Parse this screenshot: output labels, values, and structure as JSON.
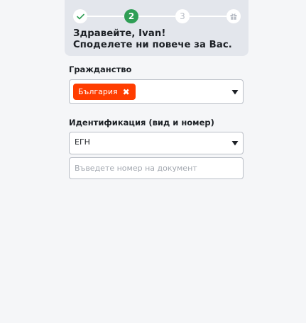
{
  "stepper": {
    "steps": [
      {
        "state": "done",
        "icon": "check-icon",
        "label": ""
      },
      {
        "state": "active",
        "label": "2"
      },
      {
        "state": "upcoming",
        "label": "3"
      },
      {
        "state": "upcoming",
        "icon": "gift-icon",
        "label": ""
      }
    ]
  },
  "greeting": {
    "line1": "Здравейте, Ivan!",
    "line2": "Споделете ни повече за Вас."
  },
  "citizenship": {
    "label": "Гражданство",
    "selected": "България",
    "remove_glyph": "✖"
  },
  "identification": {
    "label": "Идентификация (вид и номер)",
    "type_value": "ЕГН",
    "number_placeholder": "Въведете номер на документ",
    "number_value": ""
  },
  "colors": {
    "accent": "#ff3d00",
    "active_step": "#2f9e55",
    "done_check": "#2f9e55",
    "header_bg": "#e3e6ec"
  }
}
